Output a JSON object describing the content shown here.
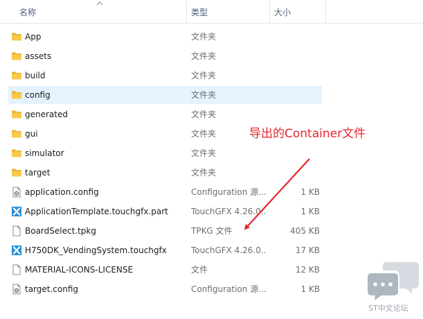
{
  "columns": {
    "name": "名称",
    "type": "类型",
    "size": "大小"
  },
  "files": [
    {
      "name": "App",
      "type": "文件夹",
      "size": "",
      "icon": "folder-icon",
      "selected": false
    },
    {
      "name": "assets",
      "type": "文件夹",
      "size": "",
      "icon": "folder-icon",
      "selected": false
    },
    {
      "name": "build",
      "type": "文件夹",
      "size": "",
      "icon": "folder-icon",
      "selected": false
    },
    {
      "name": "config",
      "type": "文件夹",
      "size": "",
      "icon": "folder-icon",
      "selected": true
    },
    {
      "name": "generated",
      "type": "文件夹",
      "size": "",
      "icon": "folder-icon",
      "selected": false
    },
    {
      "name": "gui",
      "type": "文件夹",
      "size": "",
      "icon": "folder-icon",
      "selected": false
    },
    {
      "name": "simulator",
      "type": "文件夹",
      "size": "",
      "icon": "folder-icon",
      "selected": false
    },
    {
      "name": "target",
      "type": "文件夹",
      "size": "",
      "icon": "folder-icon",
      "selected": false
    },
    {
      "name": "application.config",
      "type": "Configuration 源...",
      "size": "1 KB",
      "icon": "config-file-icon",
      "selected": false
    },
    {
      "name": "ApplicationTemplate.touchgfx.part",
      "type": "TouchGFX 4.26.0...",
      "size": "1 KB",
      "icon": "touchgfx-icon",
      "selected": false
    },
    {
      "name": "BoardSelect.tpkg",
      "type": "TPKG 文件",
      "size": "405 KB",
      "icon": "file-icon",
      "selected": false
    },
    {
      "name": "H750DK_VendingSystem.touchgfx",
      "type": "TouchGFX 4.26.0...",
      "size": "17 KB",
      "icon": "touchgfx-icon",
      "selected": false
    },
    {
      "name": "MATERIAL-ICONS-LICENSE",
      "type": "文件",
      "size": "12 KB",
      "icon": "file-icon",
      "selected": false
    },
    {
      "name": "target.config",
      "type": "Configuration 源...",
      "size": "1 KB",
      "icon": "config-file-icon",
      "selected": false
    }
  ],
  "annotation": {
    "text": "导出的Container文件",
    "color": "#e8242c"
  },
  "watermark": {
    "text": "ST中文论坛"
  },
  "colors": {
    "folder": "#f8c94a",
    "selection": "#e5f3ff",
    "touchgfx": "#2a8fd6"
  }
}
